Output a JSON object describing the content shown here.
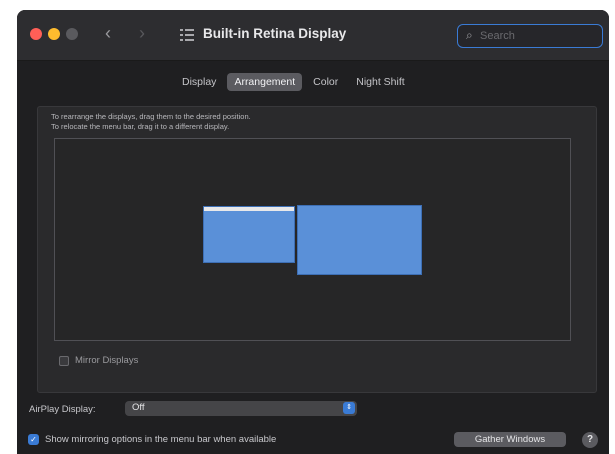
{
  "window": {
    "title": "Built-in Retina Display",
    "nav_back": "‹",
    "nav_forward": "›"
  },
  "search": {
    "placeholder": "Search",
    "glyph": "⌕"
  },
  "tabs": [
    {
      "label": "Display",
      "selected": false
    },
    {
      "label": "Arrangement",
      "selected": true
    },
    {
      "label": "Color",
      "selected": false
    },
    {
      "label": "Night Shift",
      "selected": false
    }
  ],
  "arrangement": {
    "instruction_line1": "To rearrange the displays, drag them to the desired position.",
    "instruction_line2": "To relocate the menu bar, drag it to a different display.",
    "mirror_label": "Mirror Displays",
    "mirror_checked": false
  },
  "airplay": {
    "label": "AirPlay Display:",
    "value": "Off",
    "arrows": "⇕"
  },
  "footer": {
    "show_mirroring_label": "Show mirroring options in the menu bar when available",
    "show_mirroring_checked": true,
    "checkmark": "✓",
    "gather_label": "Gather Windows",
    "help_label": "?"
  },
  "colors": {
    "accent": "#3a7bd5",
    "display_fill": "#5a90d8",
    "window_bg": "#1f1f21"
  }
}
